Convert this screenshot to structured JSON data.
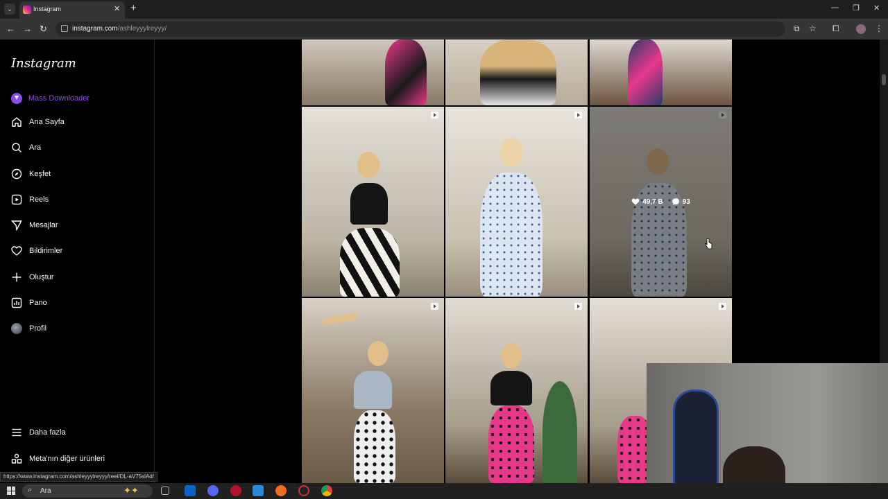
{
  "browser": {
    "tab_title": "Instagram",
    "url_host": "instagram.com",
    "url_path": "/ashleyyylreyyy/",
    "status_url": "https://www.instagram.com/ashleyyylreyyy/reel/DL-aV75slAd/"
  },
  "sidebar": {
    "logo": "Instagram",
    "mass_downloader": "Mass Downloader",
    "items": [
      {
        "label": "Ana Sayfa",
        "icon": "home-icon"
      },
      {
        "label": "Ara",
        "icon": "search-icon"
      },
      {
        "label": "Keşfet",
        "icon": "compass-icon"
      },
      {
        "label": "Reels",
        "icon": "reels-icon"
      },
      {
        "label": "Mesajlar",
        "icon": "send-icon"
      },
      {
        "label": "Bildirimler",
        "icon": "heart-icon"
      },
      {
        "label": "Oluştur",
        "icon": "plus-icon"
      },
      {
        "label": "Pano",
        "icon": "dashboard-icon"
      },
      {
        "label": "Profil",
        "icon": "avatar"
      }
    ],
    "more": "Daha fazla",
    "meta": "Meta'nın diğer ürünleri"
  },
  "hover_post": {
    "likes": "49,7 B",
    "comments": "93"
  },
  "taskbar": {
    "search_placeholder": "Ara"
  },
  "colors": {
    "accent": "#8e4cf0",
    "background": "#000000"
  }
}
